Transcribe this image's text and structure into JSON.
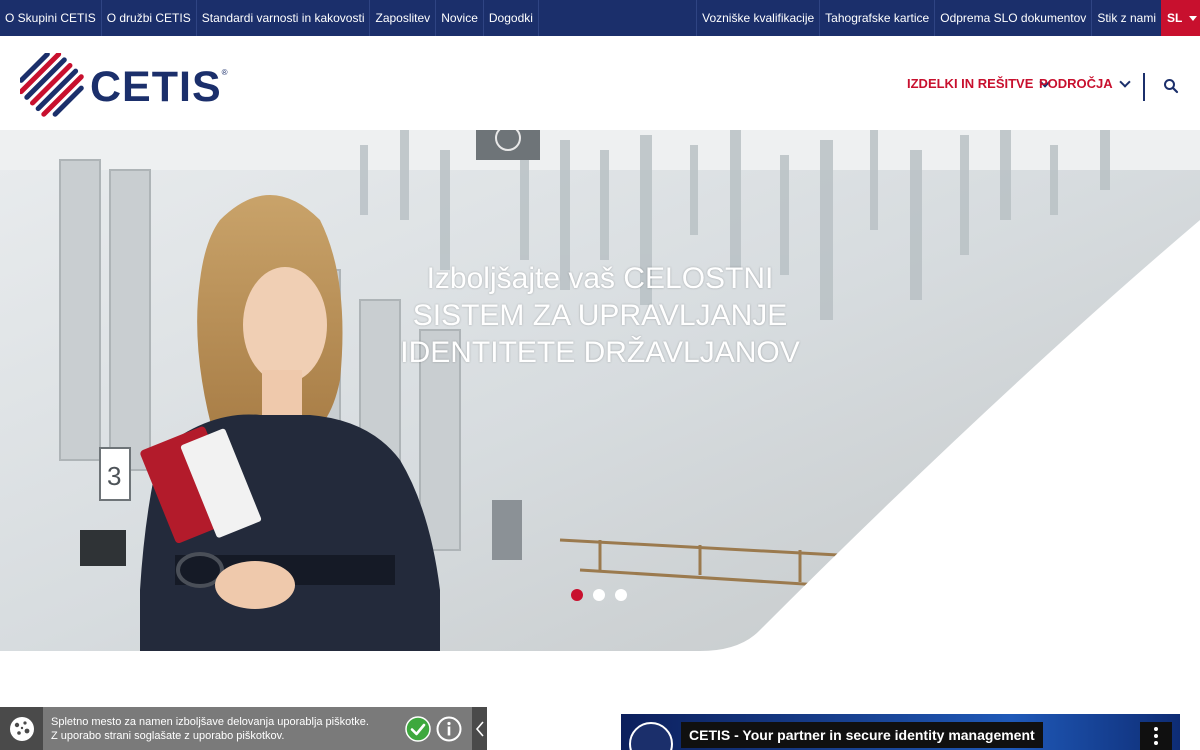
{
  "topbar": {
    "left_links": [
      "O Skupini CETIS",
      "O družbi CETIS",
      "Standardi varnosti in kakovosti",
      "Zaposlitev",
      "Novice",
      "Dogodki"
    ],
    "right_links": [
      "Vozniške kvalifikacije",
      "Tahografske kartice",
      "Odprema SLO dokumentov",
      "Stik z nami"
    ],
    "language": "SL"
  },
  "header": {
    "logo_text": "CETIS",
    "logo_mark": "®",
    "nav": [
      "IZDELKI IN REŠITVE",
      "PODROČJA"
    ]
  },
  "hero": {
    "title_lines": [
      "Izboljšajte vaš CELOSTNI",
      "SISTEM ZA UPRAVLJANJE",
      "IDENTITETE DRŽAVLJANOV"
    ],
    "slides_total": 3,
    "active_slide": 1
  },
  "cookie": {
    "line1": "Spletno mesto za namen izboljšave delovanja uporablja piškotke.",
    "line2": "Z uporabo strani soglašate z uporabo piškotkov."
  },
  "video": {
    "title": "CETIS - Your partner in secure identity management"
  },
  "colors": {
    "navy": "#1b2f6b",
    "red": "#c8102e",
    "cookie_bg": "#7a7a7a",
    "ok_green": "#3ea83e"
  }
}
